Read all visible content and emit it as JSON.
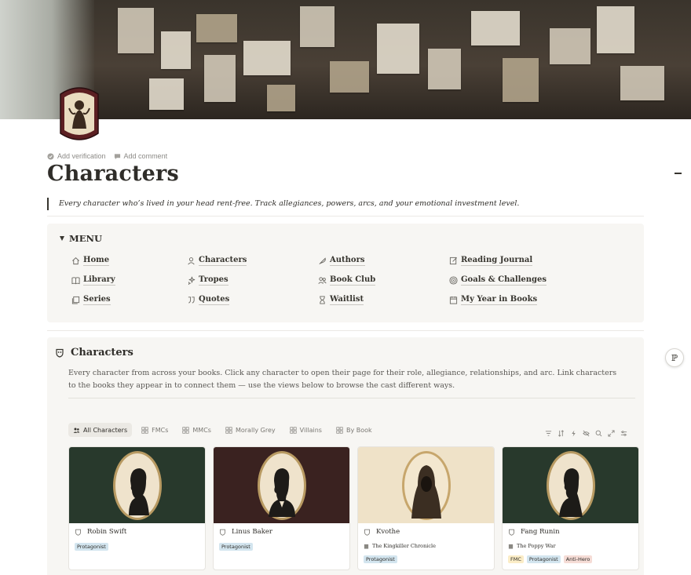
{
  "meta": {
    "add_verification": "Add verification",
    "add_comment": "Add comment"
  },
  "page": {
    "title": "Characters",
    "quote": "Every character who’s lived in your head rent-free. Track allegiances, powers, arcs, and your emotional investment level."
  },
  "menu": {
    "heading": "MENU",
    "items": [
      {
        "label": "Home",
        "icon": "house-icon"
      },
      {
        "label": "Characters",
        "icon": "person-icon"
      },
      {
        "label": "Authors",
        "icon": "quill-icon"
      },
      {
        "label": "Reading Journal",
        "icon": "note-pencil-icon"
      },
      {
        "label": "Library",
        "icon": "book-open-icon"
      },
      {
        "label": "Tropes",
        "icon": "sparkles-icon"
      },
      {
        "label": "Book Club",
        "icon": "people-icon"
      },
      {
        "label": "Goals & Challenges",
        "icon": "target-icon"
      },
      {
        "label": "Series",
        "icon": "stacked-books-icon"
      },
      {
        "label": "Quotes",
        "icon": "quote-icon"
      },
      {
        "label": "Waitlist",
        "icon": "hourglass-icon"
      },
      {
        "label": "My Year in Books",
        "icon": "calendar-icon"
      }
    ]
  },
  "section": {
    "title": "Characters",
    "description": "Every character from across your books. Click any character to open their page for their role, allegiance, relationships, and arc. Link characters to the books they appear in to connect them — use the views below to browse the cast different ways.",
    "tabs": [
      {
        "label": "All Characters",
        "icon": "people-icon"
      },
      {
        "label": "FMCs",
        "icon": "gallery-icon"
      },
      {
        "label": "MMCs",
        "icon": "gallery-icon"
      },
      {
        "label": "Morally Grey",
        "icon": "gallery-icon"
      },
      {
        "label": "Villains",
        "icon": "gallery-icon"
      },
      {
        "label": "By Book",
        "icon": "gallery-icon"
      }
    ],
    "tools": [
      "filter-icon",
      "sort-icon",
      "lightning-icon",
      "hide-icon",
      "search-icon",
      "expand-icon",
      "settings-icon"
    ],
    "cards": [
      {
        "name": "Robin Swift",
        "book": "",
        "tags": [
          "Protagonist"
        ]
      },
      {
        "name": "Linus Baker",
        "book": "",
        "tags": [
          "Protagonist"
        ]
      },
      {
        "name": "Kvothe",
        "book": "The Kingkiller Chronicle",
        "tags": [
          "Protagonist"
        ]
      },
      {
        "name": "Fang Runin",
        "book": "The Poppy War",
        "tags": [
          "FMC",
          "Protagonist",
          "Anti-Hero"
        ]
      }
    ]
  },
  "colors": {
    "card_bg_green": "#28392c",
    "card_bg_maroon": "#3a2220",
    "card_bg_cream": "#efe2c8",
    "tag_blue": "#d3e5ef",
    "tag_yellow": "#fbedc7",
    "tag_red": "#f5dcd6"
  }
}
